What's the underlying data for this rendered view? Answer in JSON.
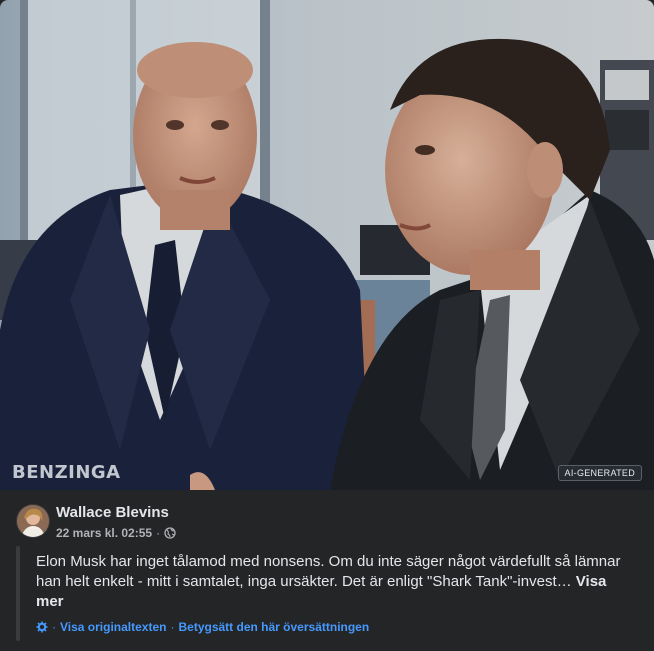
{
  "photo": {
    "watermark": "BENZINGA",
    "badge": "AI-GENERATED"
  },
  "post": {
    "author": "Wallace Blevins",
    "timestamp": "22 mars kl. 02:55",
    "separator": "·",
    "text": "Elon Musk har inget tålamod med nonsens. Om du inte säger något värdefullt så lämnar han helt enkelt - mitt i samtalet, inga ursäkter. Det är enligt \"Shark Tank\"-invest…",
    "see_more": "Visa mer",
    "translation": {
      "show_original": "Visa originaltexten",
      "rate": "Betygsätt den här översättningen",
      "separator": "·"
    }
  },
  "colors": {
    "background": "#242526",
    "link": "#4599ff",
    "text": "#e4e6eb",
    "secondary_text": "#b0b3b8"
  },
  "icons": [
    "globe-icon",
    "translate-gear-icon"
  ]
}
